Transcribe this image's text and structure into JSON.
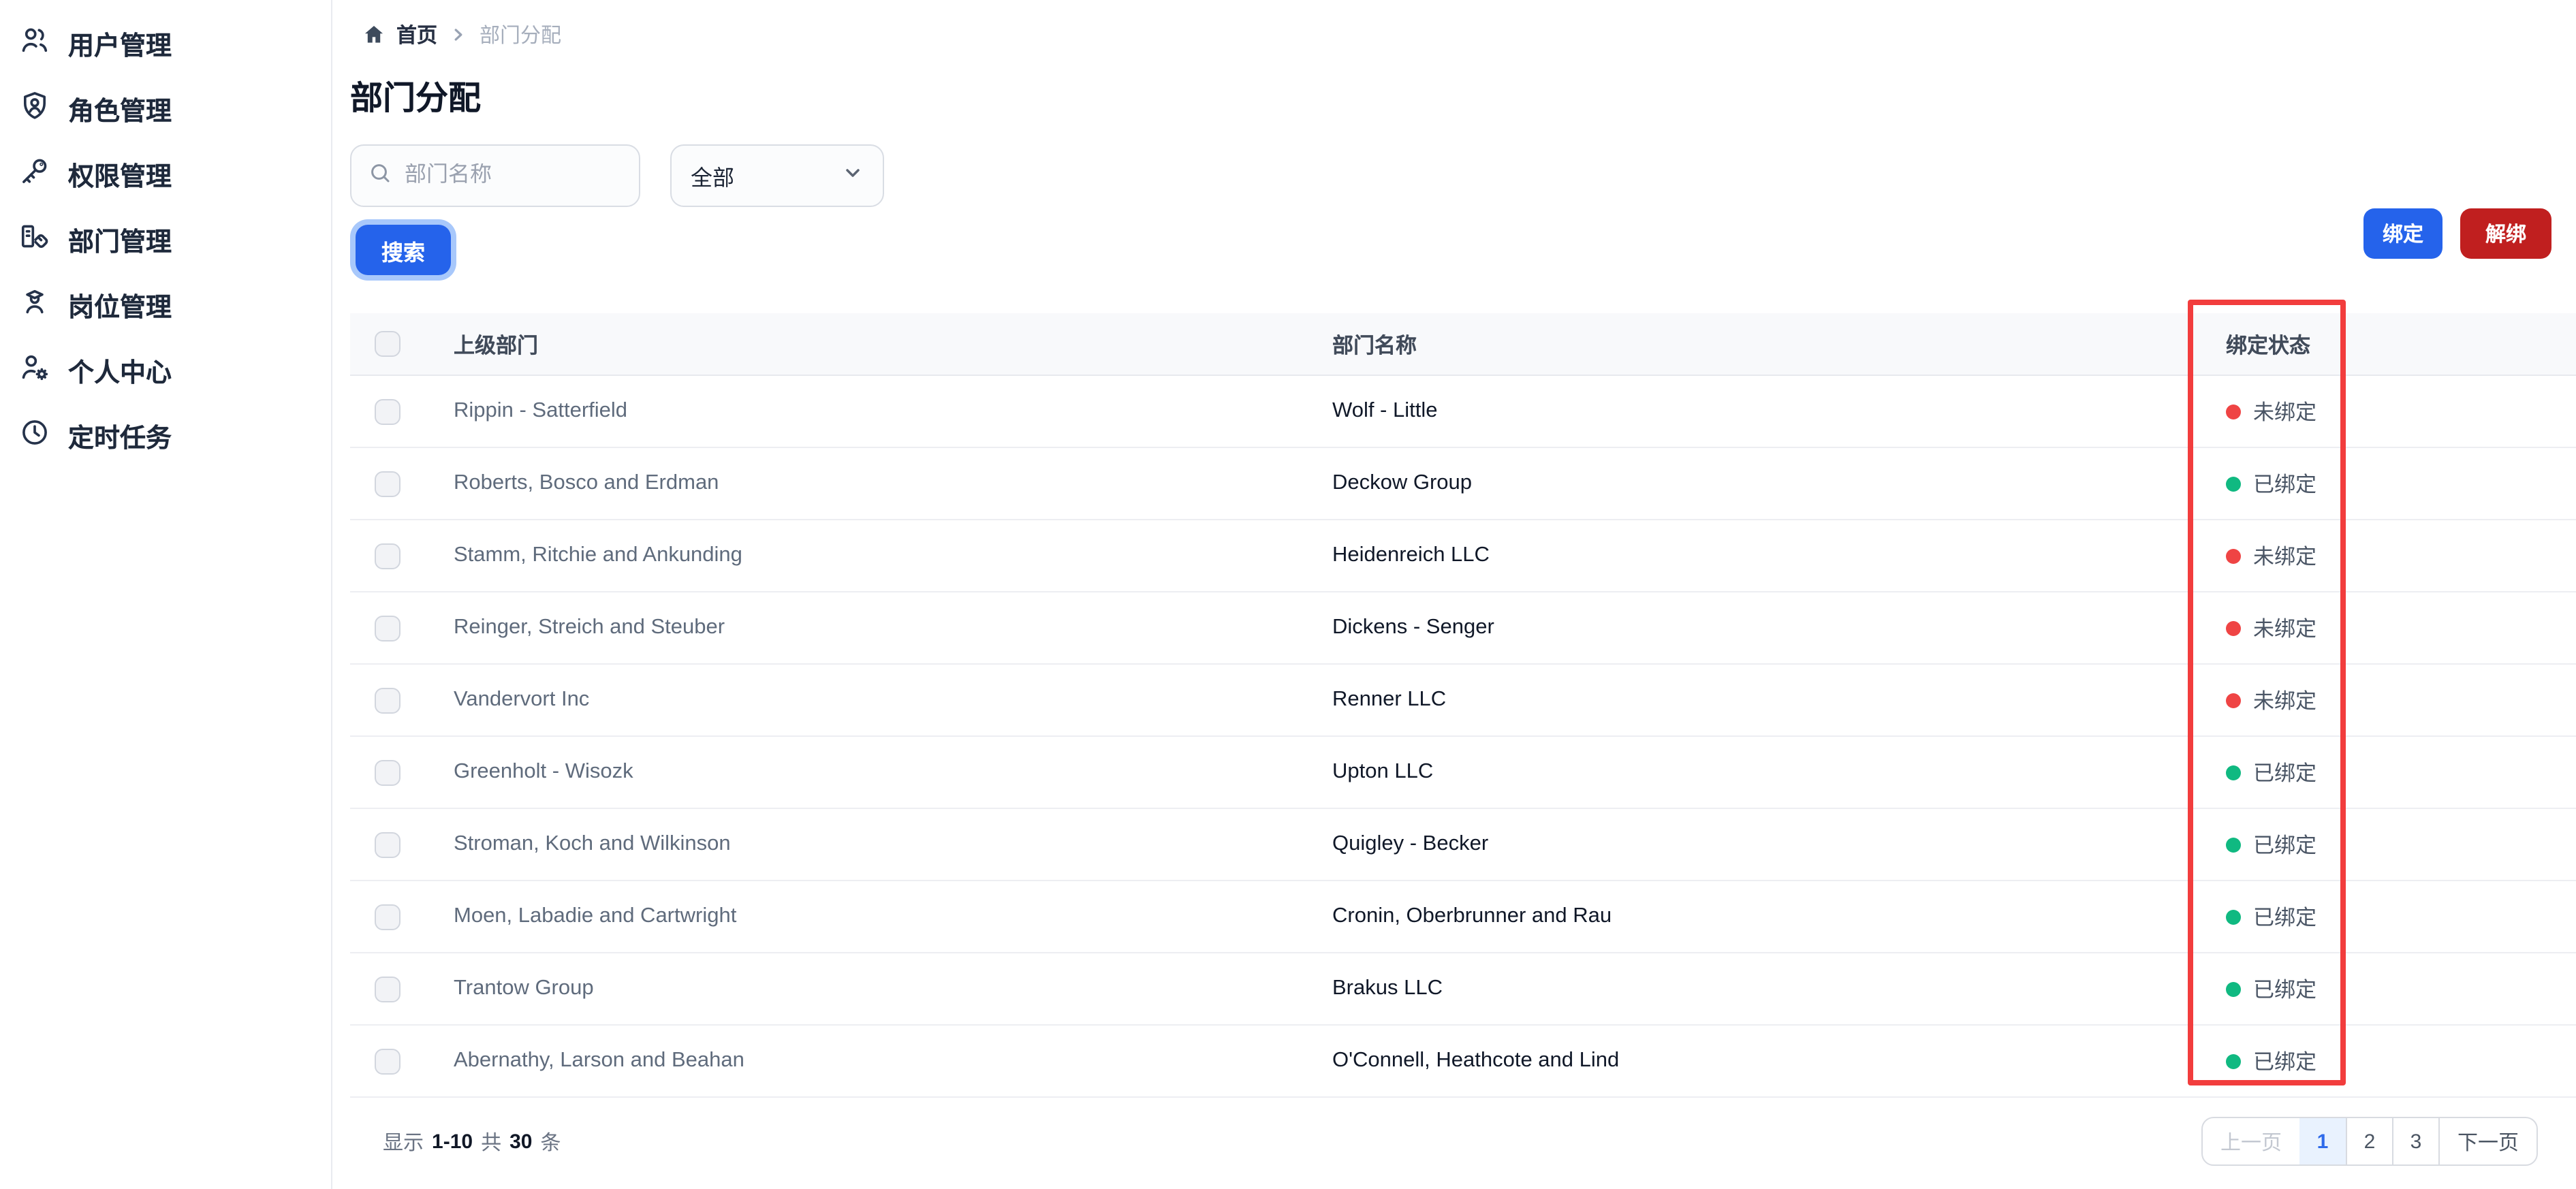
{
  "sidebar": {
    "items": [
      {
        "label": "用户管理",
        "icon": "users-icon"
      },
      {
        "label": "角色管理",
        "icon": "shield-user-icon"
      },
      {
        "label": "权限管理",
        "icon": "key-icon"
      },
      {
        "label": "部门管理",
        "icon": "department-icon"
      },
      {
        "label": "岗位管理",
        "icon": "position-icon"
      },
      {
        "label": "个人中心",
        "icon": "user-gear-icon"
      },
      {
        "label": "定时任务",
        "icon": "clock-icon"
      }
    ]
  },
  "breadcrumb": {
    "home": "首页",
    "current": "部门分配"
  },
  "page": {
    "title": "部门分配"
  },
  "filters": {
    "search_placeholder": "部门名称",
    "select_value": "全部",
    "search_button": "搜索"
  },
  "actions": {
    "bind": "绑定",
    "unbind": "解绑"
  },
  "table": {
    "columns": {
      "parent": "上级部门",
      "name": "部门名称",
      "status": "绑定状态"
    },
    "rows": [
      {
        "parent": "Rippin - Satterfield",
        "name": "Wolf - Little",
        "status": "未绑定",
        "bound": false
      },
      {
        "parent": "Roberts, Bosco and Erdman",
        "name": "Deckow Group",
        "status": "已绑定",
        "bound": true
      },
      {
        "parent": "Stamm, Ritchie and Ankunding",
        "name": "Heidenreich LLC",
        "status": "未绑定",
        "bound": false
      },
      {
        "parent": "Reinger, Streich and Steuber",
        "name": "Dickens - Senger",
        "status": "未绑定",
        "bound": false
      },
      {
        "parent": "Vandervort Inc",
        "name": "Renner LLC",
        "status": "未绑定",
        "bound": false
      },
      {
        "parent": "Greenholt - Wisozk",
        "name": "Upton LLC",
        "status": "已绑定",
        "bound": true
      },
      {
        "parent": "Stroman, Koch and Wilkinson",
        "name": "Quigley - Becker",
        "status": "已绑定",
        "bound": true
      },
      {
        "parent": "Moen, Labadie and Cartwright",
        "name": "Cronin, Oberbrunner and Rau",
        "status": "已绑定",
        "bound": true
      },
      {
        "parent": "Trantow Group",
        "name": "Brakus LLC",
        "status": "已绑定",
        "bound": true
      },
      {
        "parent": "Abernathy, Larson and Beahan",
        "name": "O'Connell, Heathcote and Lind",
        "status": "已绑定",
        "bound": true
      }
    ]
  },
  "pagination": {
    "summary": {
      "prefix": "显示",
      "range": "1-10",
      "join": "共",
      "total": "30",
      "unit": "条"
    },
    "prev": "上一页",
    "pages": [
      "1",
      "2",
      "3"
    ],
    "active_page": "1",
    "next": "下一页"
  },
  "colors": {
    "primary": "#2563eb",
    "danger": "#c01f1f",
    "focus_ring": "#a8c8fb",
    "bound_dot": "#10b981",
    "unbound_dot": "#ef4444",
    "annotation": "#f23d3d",
    "active_page_bg": "#e9f2fe",
    "active_page_text": "#2f6bea",
    "sidebar_text": "#1e293b"
  }
}
